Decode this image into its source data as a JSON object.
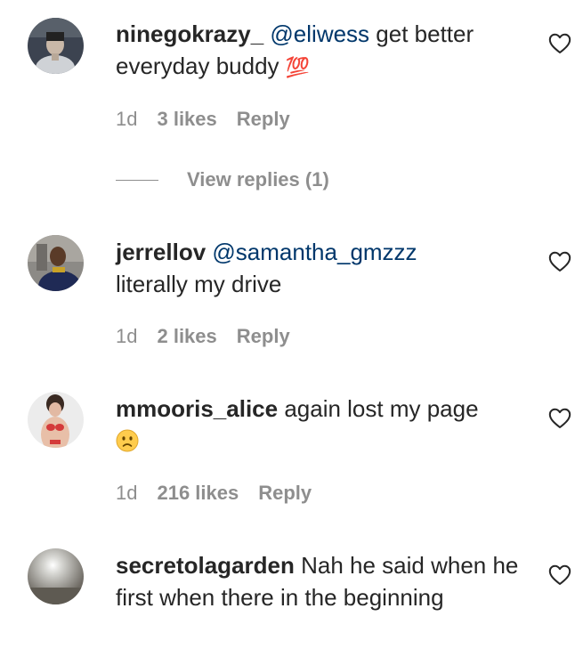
{
  "comments": [
    {
      "username": "ninegokrazy_",
      "mention": "@eliwess",
      "text_line1": " get better",
      "text_line2": "everyday buddy ",
      "emoji": "💯",
      "time": "1d",
      "likes": "3 likes",
      "reply": "Reply",
      "view_replies": "View replies (1)"
    },
    {
      "username": "jerrellov",
      "mention": "@samantha_gmzzz",
      "text": "literally my drive",
      "time": "1d",
      "likes": "2 likes",
      "reply": "Reply"
    },
    {
      "username": "mmooris_alice",
      "text": " again lost my page",
      "emoji": "sad-face-emoji",
      "time": "1d",
      "likes": "216 likes",
      "reply": "Reply"
    },
    {
      "username": "secretolagarden",
      "text": " Nah he said when he first when there in the beginning"
    }
  ],
  "icons": {
    "like": "heart-outline-icon"
  },
  "colors": {
    "text": "#262626",
    "secondary": "#8e8e8e",
    "mention": "#00376b"
  }
}
